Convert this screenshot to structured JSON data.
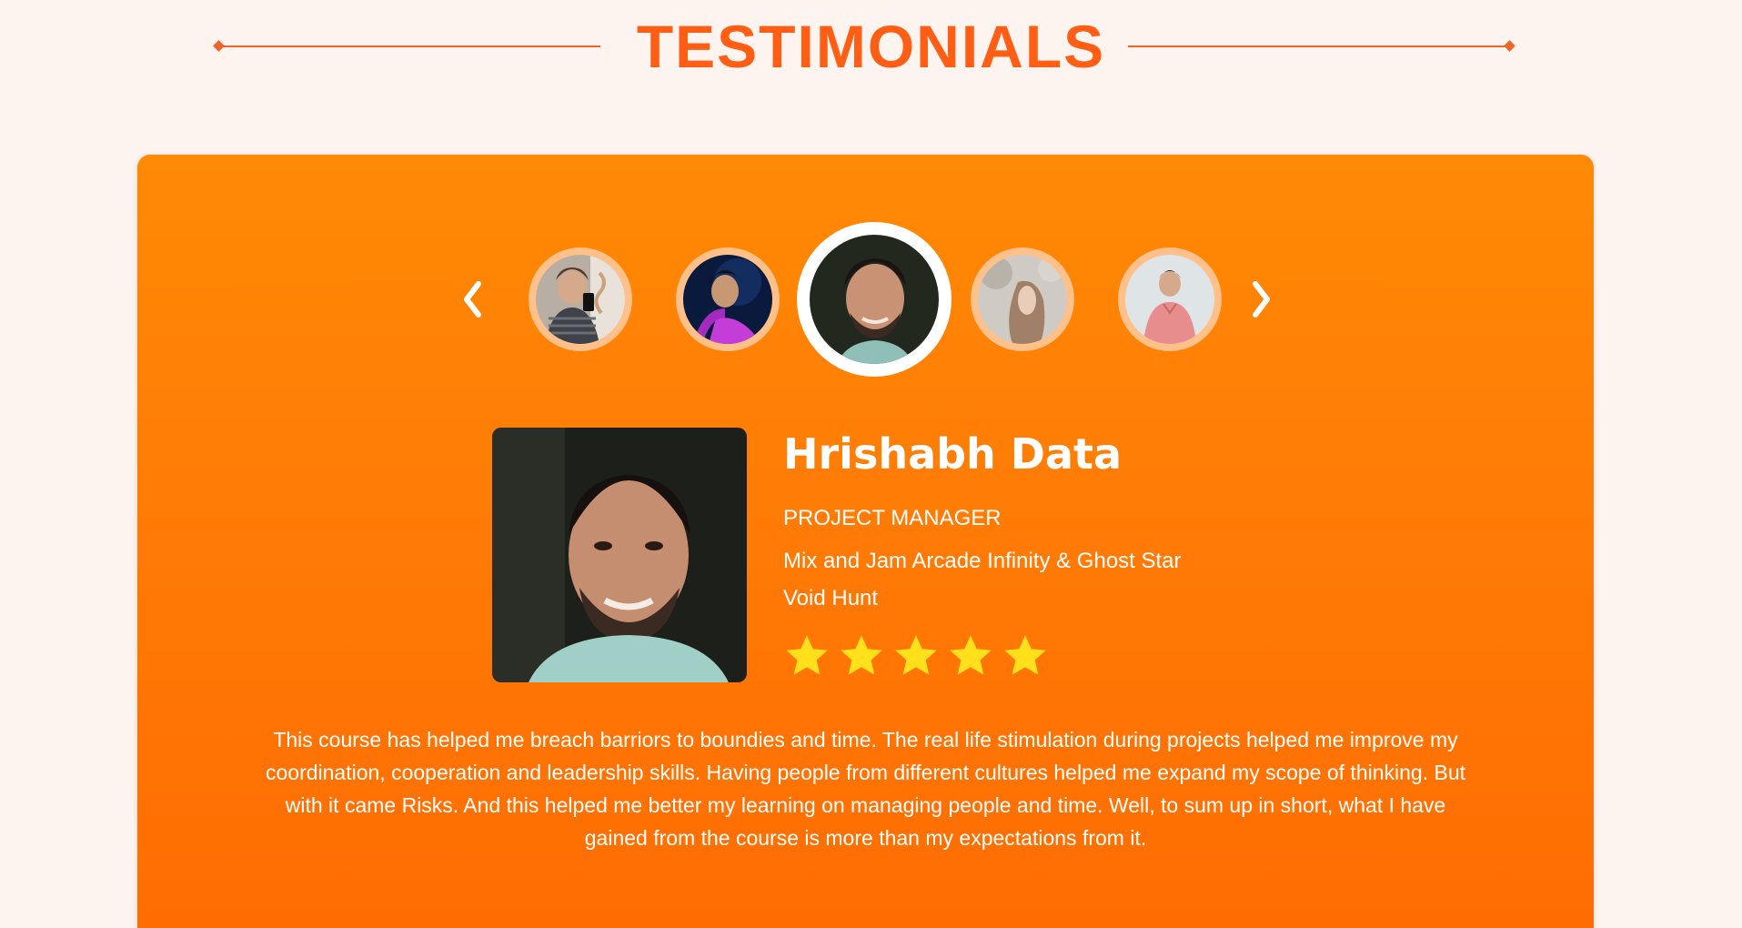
{
  "heading": {
    "title": "TESTIMONIALS"
  },
  "colors": {
    "accent": "#ff5e14",
    "card_top": "#ff8a05",
    "card_bottom": "#ff6c02",
    "page_bg": "#fef4ef",
    "star": "#ffe01a",
    "thumb_ring": "#ffc08a"
  },
  "carousel": {
    "prev_icon": "chevron-left-icon",
    "next_icon": "chevron-right-icon",
    "active_index": 2,
    "avatars_count": 5
  },
  "testimonial": {
    "name": "Hrishabh Data",
    "role": "PROJECT MANAGER",
    "company": "Mix and Jam Arcade Infinity & Ghost Star Void Hunt",
    "rating": 5,
    "rating_max": 5,
    "quote": "This course has helped me breach barriors to boundies and time. The real life stimulation during projects helped me improve my coordination, cooperation and leadership skills. Having people from different cultures helped me expand my scope of thinking. But with it came Risks. And this helped me better my learning on managing people and time. Well, to sum up in short, what I have gained from the course is more than my expectations from it."
  }
}
